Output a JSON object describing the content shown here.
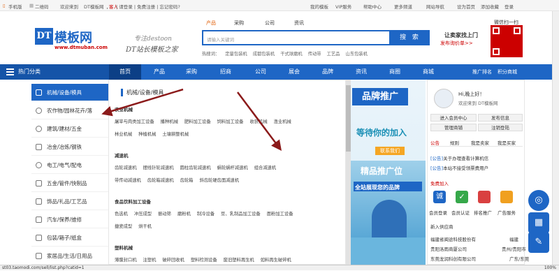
{
  "topbar": {
    "left": [
      "手机版",
      "二维码",
      "欢迎来到",
      "DT模板网",
      "，",
      "客人",
      "| 请登录 | 免费注册 | 忘记密码?"
    ],
    "right": [
      "我的模板",
      "VIP服务",
      "帮助中心",
      "更多频道",
      "网站导航",
      "设为首页",
      "添加收藏",
      "登录"
    ]
  },
  "logo": {
    "box": "DT",
    "name": "模板网",
    "url": "www.dtmuban.com",
    "slogan1": "专注destoon",
    "slogan2": "DT站长模板之家"
  },
  "search": {
    "tabs": [
      "产品",
      "采购",
      "公司",
      "资讯"
    ],
    "placeholder": "请输入关键词",
    "button": "搜 索",
    "hot_label": "热搜词：",
    "hot": [
      "定量包装机",
      "成都包装机",
      "干式球磨机",
      "传动带",
      "工艺品",
      "山东包装机"
    ]
  },
  "shop": {
    "line1": "让卖家找上门",
    "line2": "发布询价单>>"
  },
  "qr": {
    "title": "微信扫一扫"
  },
  "nav": {
    "category": "热门分类",
    "items": [
      "首页",
      "产品",
      "采购",
      "招商",
      "公司",
      "展会",
      "品牌",
      "资讯",
      "商圈",
      "商城"
    ],
    "right": [
      "推广排名",
      "积分商城"
    ]
  },
  "sidebar": [
    "机械/设备/模具",
    "农作物/园林花卉/落",
    "建筑/建材/五金",
    "冶金/冶炼/钢铁",
    "电工/电气/配电",
    "五金/管件/快制品",
    "饰品/礼品/工艺品",
    "汽车/保养/维修",
    "包装/箱子/纸盒",
    "家居品/生活/日用品"
  ],
  "mega": {
    "title": "机械/设备/模具",
    "groups": [
      {
        "name": "农业机械",
        "items": [
          [
            "屠宰与肉类加工设备",
            "播种机械",
            "肥料加工设备",
            "饲料加工设备",
            "收获机械",
            "渔业机械"
          ],
          [
            "林业机械",
            "种植机械",
            "土壤耕整机械"
          ]
        ]
      },
      {
        "name": "减速机",
        "items": [
          [
            "齿轮减速机",
            "摆线针轮减速机",
            "圆柱齿轮减速机",
            "蜗轮蜗杆减速机",
            "组合减速机"
          ],
          [
            "带传动减速机",
            "齿轮箱减速机",
            "齿轮箱",
            "斜齿轮硬齿面减速机"
          ]
        ]
      },
      {
        "name": "食品饮料加工设备",
        "items": [
          [
            "色选机",
            "冲压成型",
            "振动筛",
            "磨粉机",
            "制冷设备",
            "豆、乳制品加工设备",
            "面粉加工设备"
          ],
          [
            "搪瓷成型",
            "烘干机"
          ]
        ]
      },
      {
        "name": "塑料机械",
        "items": [
          [
            "薄膜封口机",
            "注塑机",
            "破碎回收机",
            "塑料检测设备",
            "废旧塑料再生机",
            "如料再生破碎机"
          ]
        ]
      }
    ]
  },
  "ad": {
    "b1": "品牌推广",
    "t2": "等待你的加入",
    "btn": "联系我们",
    "t3": "精品推广位",
    "t5": "全站展现您的品牌"
  },
  "user": {
    "greet": "Hi,晚上好！",
    "welcome": "欢迎来到 DT模板网",
    "buttons": [
      "进入会员中心",
      "发布信息",
      "管理商铺",
      "注销登陆"
    ],
    "tabs": [
      "公告",
      "规则",
      "我是卖家",
      "我是买家"
    ],
    "news": [
      {
        "tag": "[公告]",
        "text": "关于办理查看计算机信"
      },
      {
        "tag": "[公告]",
        "text": "本站不接受领票费用户"
      }
    ],
    "free": "免费加入",
    "services": [
      "会员登录",
      "会员认证",
      "排名推广",
      "广告服务"
    ],
    "newsup": "新入供应商",
    "suppliers": [
      {
        "name": "福建省闽途科技股份有",
        "city": "福建"
      },
      {
        "name": "贵阳洛雨商厦公司",
        "city": "贵州/贵阳市"
      },
      {
        "name": "东莞龙润科创有限公司",
        "city": "广东/东莞"
      }
    ]
  },
  "statusbar": {
    "url": "st03.taomodi.com/sell/list.php?catid=1",
    "zoom": "100%"
  },
  "colors": {
    "primary": "#1e66c5",
    "red": "#cc0000",
    "arrow": "#8b1a1a"
  }
}
